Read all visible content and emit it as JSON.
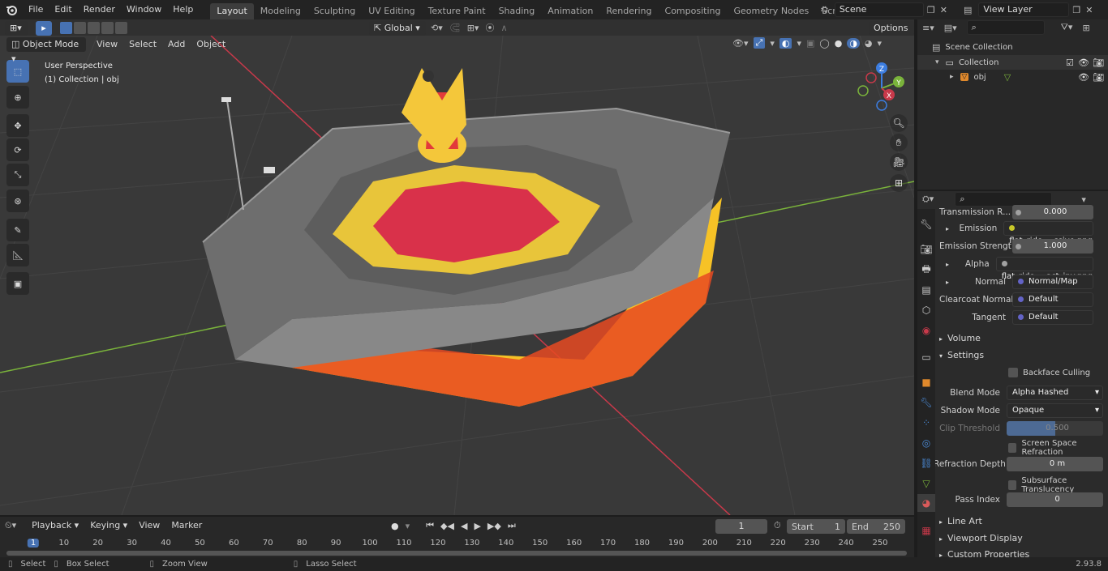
{
  "menu": [
    "File",
    "Edit",
    "Render",
    "Window",
    "Help"
  ],
  "workspaces": [
    "Layout",
    "Modeling",
    "Sculpting",
    "UV Editing",
    "Texture Paint",
    "Shading",
    "Animation",
    "Rendering",
    "Compositing",
    "Geometry Nodes",
    "Scripting"
  ],
  "active_workspace": "Layout",
  "scene_name": "Scene",
  "view_layer": "View Layer",
  "viewport": {
    "mode": "Object Mode",
    "menus": [
      "View",
      "Select",
      "Add",
      "Object"
    ],
    "transform_orientation": "Global",
    "options_label": "Options",
    "overlay_title": "User Perspective",
    "overlay_subtitle": "(1) Collection | obj"
  },
  "gizmo": {
    "z": "Z",
    "y": "Y",
    "x": "X"
  },
  "outliner": {
    "root": "Scene Collection",
    "collection": "Collection",
    "object": "obj"
  },
  "properties": {
    "transmission_label": "Transmission R...",
    "transmission_value": "0.000",
    "emission_label": "Emission",
    "emission_value": "flat_ride_...ssive.png",
    "emission_strength_label": "Emission Strengt",
    "emission_strength_value": "1.000",
    "alpha_label": "Alpha",
    "alpha_value": "flat_ride_...act_inv.png",
    "normal_label": "Normal",
    "normal_value": "Normal/Map",
    "clearcoat_normal_label": "Clearcoat Normal",
    "clearcoat_normal_value": "Default",
    "tangent_label": "Tangent",
    "tangent_value": "Default",
    "volume_panel": "Volume",
    "settings_panel": "Settings",
    "backface_culling": "Backface Culling",
    "blend_mode_label": "Blend Mode",
    "blend_mode_value": "Alpha Hashed",
    "shadow_mode_label": "Shadow Mode",
    "shadow_mode_value": "Opaque",
    "clip_threshold_label": "Clip Threshold",
    "clip_threshold_value": "0.500",
    "clip_threshold_fraction": 0.5,
    "ssr_label": "Screen Space Refraction",
    "refraction_depth_label": "Refraction Depth",
    "refraction_depth_value": "0 m",
    "subsurface_label": "Subsurface Translucency",
    "pass_index_label": "Pass Index",
    "pass_index_value": "0",
    "line_art_panel": "Line Art",
    "viewport_display_panel": "Viewport Display",
    "custom_properties_panel": "Custom Properties"
  },
  "timeline": {
    "menus": [
      "Playback",
      "Keying",
      "View",
      "Marker"
    ],
    "current_frame": "1",
    "start_label": "Start",
    "start_value": "1",
    "end_label": "End",
    "end_value": "250",
    "ticks": [
      "1",
      "10",
      "20",
      "30",
      "40",
      "50",
      "60",
      "70",
      "80",
      "90",
      "100",
      "110",
      "120",
      "130",
      "140",
      "150",
      "160",
      "170",
      "180",
      "190",
      "200",
      "210",
      "220",
      "230",
      "240",
      "250"
    ]
  },
  "status": {
    "select": "Select",
    "box_select": "Box Select",
    "zoom_view": "Zoom View",
    "lasso_select": "Lasso Select",
    "version": "2.93.8"
  },
  "colors": {
    "accent": "#4772b3",
    "x_axis": "#c8394a",
    "y_axis": "#7ab33b",
    "z_axis": "#3c7de0"
  }
}
